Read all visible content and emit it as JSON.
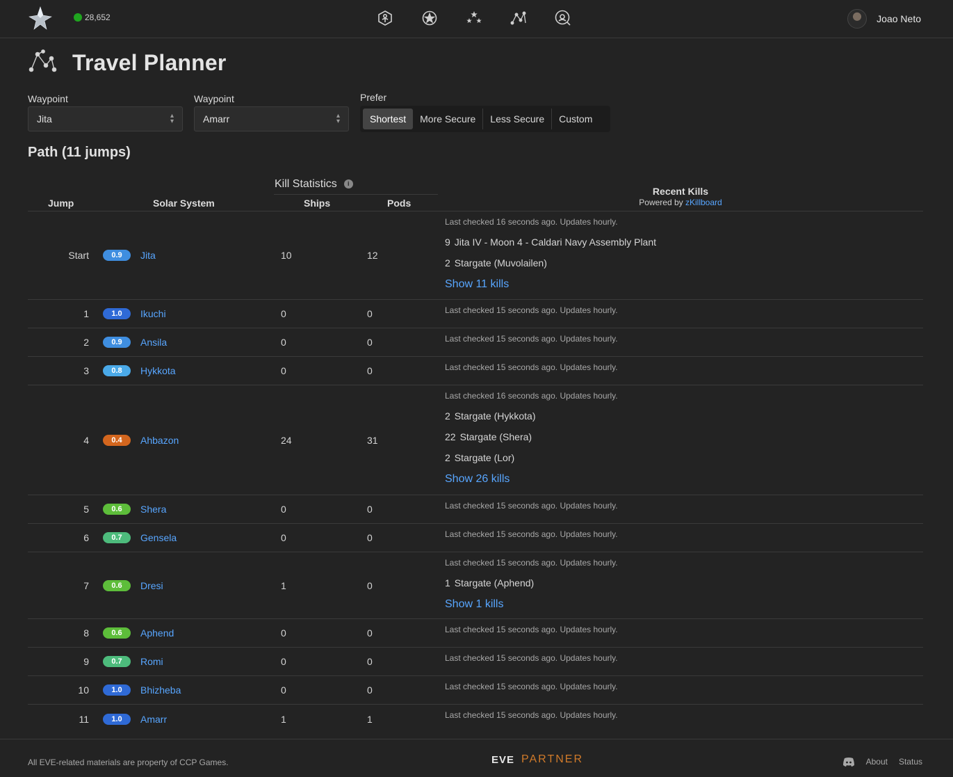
{
  "header": {
    "online_count": "28,652",
    "user_name": "Joao Neto",
    "nav_icons": [
      "character-icon",
      "corporation-icon",
      "universe-icon",
      "travel-planner-icon",
      "search-icon"
    ]
  },
  "page": {
    "title": "Travel Planner"
  },
  "form": {
    "waypoint_label": "Waypoint",
    "waypoint1": "Jita",
    "waypoint2": "Amarr",
    "prefer_label": "Prefer",
    "prefer_options": [
      "Shortest",
      "More Secure",
      "Less Secure",
      "Custom"
    ],
    "prefer_selected": "Shortest"
  },
  "path_title": "Path (11 jumps)",
  "table": {
    "headers": {
      "jump": "Jump",
      "system": "Solar System",
      "kill_stats": "Kill Statistics",
      "info_icon": "i",
      "ships": "Ships",
      "pods": "Pods",
      "recent_kills": "Recent Kills",
      "powered_by": "Powered by",
      "zkill": "zKillboard"
    },
    "rows": [
      {
        "jump": "Start",
        "sec": "0.9",
        "color": "#3f8ee0",
        "system": "Jita",
        "ships": "10",
        "pods": "12",
        "checked": "Last checked 16 seconds ago. Updates hourly.",
        "kills": [
          {
            "n": "9",
            "loc": "Jita IV - Moon 4 - Caldari Navy Assembly Plant"
          },
          {
            "n": "2",
            "loc": "Stargate (Muvolailen)"
          }
        ],
        "show": "Show 11 kills"
      },
      {
        "jump": "1",
        "sec": "1.0",
        "color": "#2f6ad6",
        "system": "Ikuchi",
        "ships": "0",
        "pods": "0",
        "checked": "Last checked 15 seconds ago. Updates hourly.",
        "kills": [],
        "show": ""
      },
      {
        "jump": "2",
        "sec": "0.9",
        "color": "#3f8ee0",
        "system": "Ansila",
        "ships": "0",
        "pods": "0",
        "checked": "Last checked 15 seconds ago. Updates hourly.",
        "kills": [],
        "show": ""
      },
      {
        "jump": "3",
        "sec": "0.8",
        "color": "#4aa9e8",
        "system": "Hykkota",
        "ships": "0",
        "pods": "0",
        "checked": "Last checked 15 seconds ago. Updates hourly.",
        "kills": [],
        "show": ""
      },
      {
        "jump": "4",
        "sec": "0.4",
        "color": "#d3661e",
        "system": "Ahbazon",
        "ships": "24",
        "pods": "31",
        "checked": "Last checked 16 seconds ago. Updates hourly.",
        "kills": [
          {
            "n": "2",
            "loc": "Stargate (Hykkota)"
          },
          {
            "n": "22",
            "loc": "Stargate (Shera)"
          },
          {
            "n": "2",
            "loc": "Stargate (Lor)"
          }
        ],
        "show": "Show 26 kills"
      },
      {
        "jump": "5",
        "sec": "0.6",
        "color": "#5dbd3a",
        "system": "Shera",
        "ships": "0",
        "pods": "0",
        "checked": "Last checked 15 seconds ago. Updates hourly.",
        "kills": [],
        "show": ""
      },
      {
        "jump": "6",
        "sec": "0.7",
        "color": "#4dbb7c",
        "system": "Gensela",
        "ships": "0",
        "pods": "0",
        "checked": "Last checked 15 seconds ago. Updates hourly.",
        "kills": [],
        "show": ""
      },
      {
        "jump": "7",
        "sec": "0.6",
        "color": "#5dbd3a",
        "system": "Dresi",
        "ships": "1",
        "pods": "0",
        "checked": "Last checked 15 seconds ago. Updates hourly.",
        "kills": [
          {
            "n": "1",
            "loc": "Stargate (Aphend)"
          }
        ],
        "show": "Show 1 kills"
      },
      {
        "jump": "8",
        "sec": "0.6",
        "color": "#5dbd3a",
        "system": "Aphend",
        "ships": "0",
        "pods": "0",
        "checked": "Last checked 15 seconds ago. Updates hourly.",
        "kills": [],
        "show": ""
      },
      {
        "jump": "9",
        "sec": "0.7",
        "color": "#4dbb7c",
        "system": "Romi",
        "ships": "0",
        "pods": "0",
        "checked": "Last checked 15 seconds ago. Updates hourly.",
        "kills": [],
        "show": ""
      },
      {
        "jump": "10",
        "sec": "1.0",
        "color": "#2f6ad6",
        "system": "Bhizheba",
        "ships": "0",
        "pods": "0",
        "checked": "Last checked 15 seconds ago. Updates hourly.",
        "kills": [],
        "show": ""
      },
      {
        "jump": "11",
        "sec": "1.0",
        "color": "#2f6ad6",
        "system": "Amarr",
        "ships": "1",
        "pods": "1",
        "checked": "Last checked 15 seconds ago. Updates hourly.",
        "kills": [],
        "show": ""
      }
    ]
  },
  "footer": {
    "copyright": "All EVE-related materials are property of CCP Games.",
    "eve": "EVE",
    "partner": "PARTNER",
    "about": "About",
    "status": "Status"
  }
}
